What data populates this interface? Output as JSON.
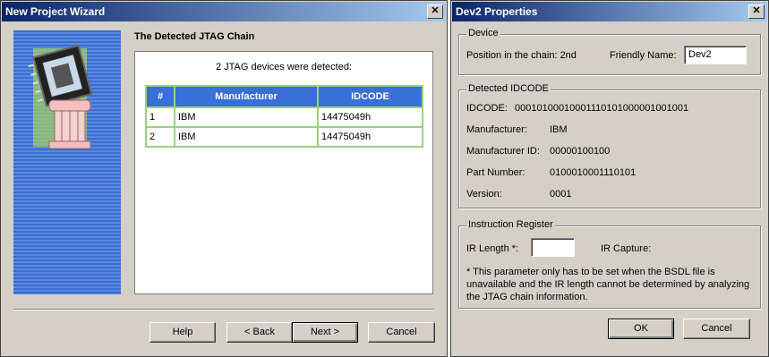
{
  "wizard": {
    "title": "New Project Wizard",
    "close": "✕",
    "heading": "The Detected JTAG Chain",
    "detected_msg": "2 JTAG devices were detected:",
    "table": {
      "headers": [
        "#",
        "Manufacturer",
        "IDCODE"
      ],
      "rows": [
        [
          "1",
          "IBM",
          "14475049h"
        ],
        [
          "2",
          "IBM",
          "14475049h"
        ]
      ]
    },
    "buttons": {
      "help": "Help",
      "back": "< Back",
      "next": "Next >",
      "cancel": "Cancel"
    }
  },
  "props": {
    "title": "Dev2 Properties",
    "close": "✕",
    "device": {
      "group_title": "Device",
      "position_label": "Position in the chain: 2nd",
      "friendly_label": "Friendly Name:",
      "friendly_value": "Dev2"
    },
    "idcode": {
      "group_title": "Detected IDCODE",
      "idcode_label": "IDCODE:",
      "idcode_value": "00010100010001110101000001001001",
      "manufacturer_label": "Manufacturer:",
      "manufacturer_value": "IBM",
      "manufacturer_id_label": "Manufacturer ID:",
      "manufacturer_id_value": "00000100100",
      "part_label": "Part Number:",
      "part_value": "0100010001110101",
      "version_label": "Version:",
      "version_value": "0001"
    },
    "ir": {
      "group_title": "Instruction Register",
      "length_label": "IR Length *:",
      "length_value": "",
      "capture_label": "IR Capture:",
      "note": "* This parameter only has to be set when the BSDL file is unavailable and the IR length cannot be determined by analyzing the JTAG chain information."
    },
    "buttons": {
      "ok": "OK",
      "cancel": "Cancel"
    }
  }
}
